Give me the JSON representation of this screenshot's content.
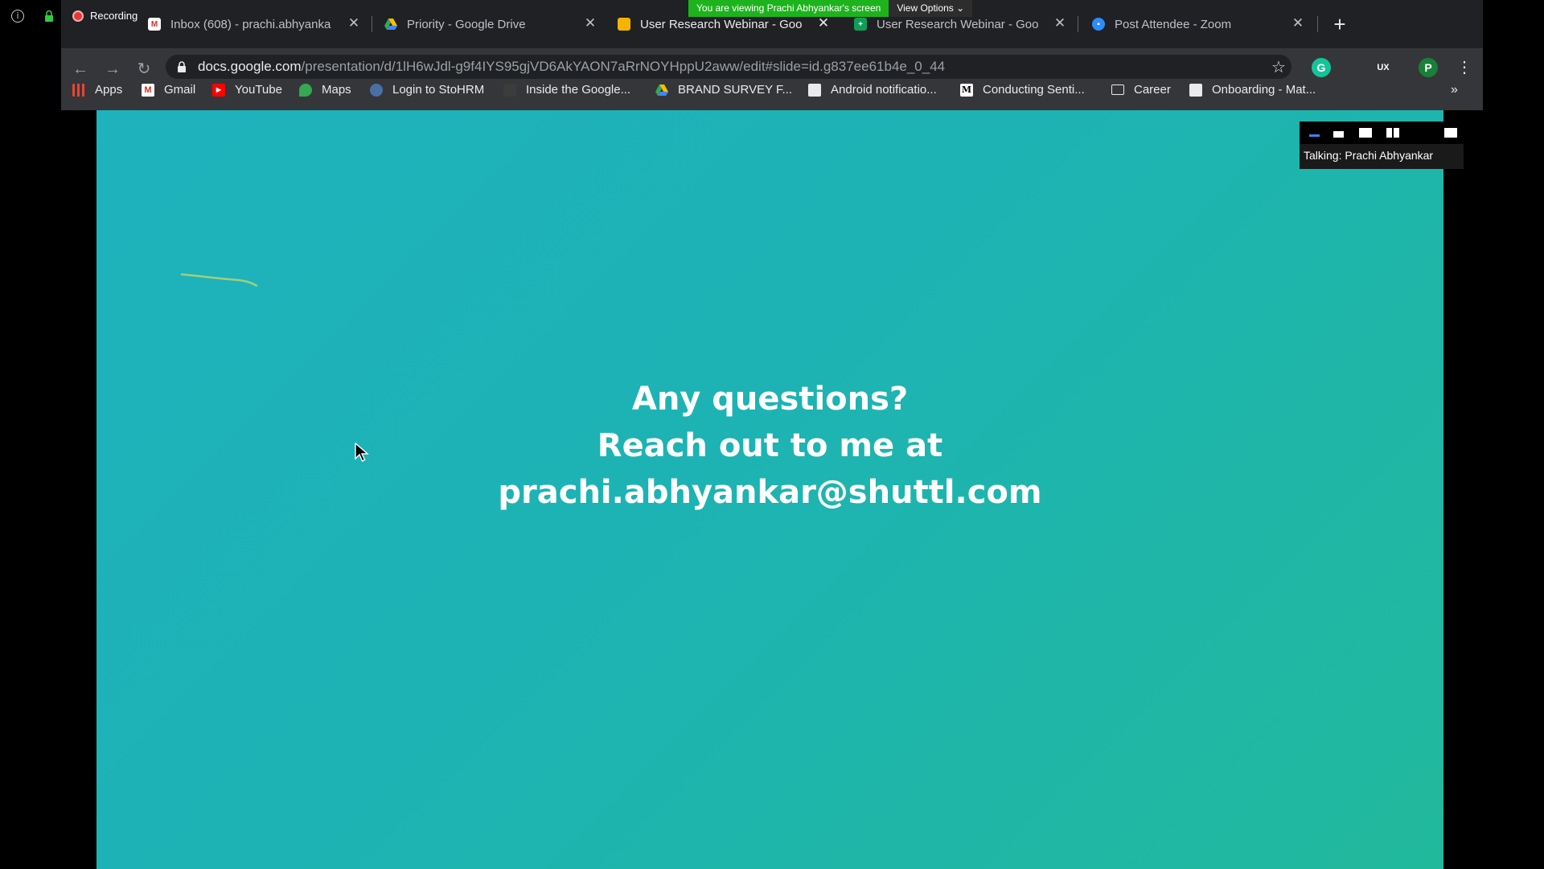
{
  "zoom": {
    "recording_label": "Recording",
    "banner_text": "You are viewing Prachi Abhyankar's screen",
    "view_options_label": "View Options",
    "talking_label": "Talking: Prachi Abhyankar"
  },
  "tabs": [
    {
      "title": "Inbox (608) - prachi.abhyanka",
      "icon": "gmail-icon"
    },
    {
      "title": "Priority - Google Drive",
      "icon": "google-drive-icon"
    },
    {
      "title": "User Research Webinar - Goo",
      "icon": "google-slides-icon"
    },
    {
      "title": "User Research Webinar - Goo",
      "icon": "google-sheets-icon"
    },
    {
      "title": "Post Attendee - Zoom",
      "icon": "zoom-icon"
    }
  ],
  "address_bar": {
    "host": "docs.google.com",
    "path": "/presentation/d/1lH6wJdl-g9f4IYS95gjVD6AkYAON7aRrNOYHppU2aww/edit#slide=id.g837ee61b4e_0_44"
  },
  "profile_initial": "P",
  "bookmarks": [
    {
      "label": "Apps",
      "icon": "apps-grid-icon"
    },
    {
      "label": "Gmail",
      "icon": "gmail-icon"
    },
    {
      "label": "YouTube",
      "icon": "youtube-icon"
    },
    {
      "label": "Maps",
      "icon": "maps-icon"
    },
    {
      "label": "Login to StoHRM",
      "icon": "stohrm-icon"
    },
    {
      "label": "Inside the Google...",
      "icon": "page-icon"
    },
    {
      "label": "BRAND SURVEY F...",
      "icon": "google-drive-icon"
    },
    {
      "label": "Android notificatio...",
      "icon": "page-icon"
    },
    {
      "label": "Conducting Senti...",
      "icon": "medium-icon"
    },
    {
      "label": "Career",
      "icon": "folder-icon"
    },
    {
      "label": "Onboarding - Mat...",
      "icon": "page-icon"
    }
  ],
  "bookmarks_overflow": "»",
  "slide": {
    "line1": "Any questions?",
    "line2": "Reach out to me at",
    "line3": "prachi.abhyankar@shuttl.com"
  },
  "colors": {
    "slide_gradient_start": "#1eb2bd",
    "slide_gradient_end": "#21b99c",
    "zoom_banner_green": "#1db31d",
    "browser_tabbar": "#202124",
    "browser_toolbar": "#35363a"
  }
}
